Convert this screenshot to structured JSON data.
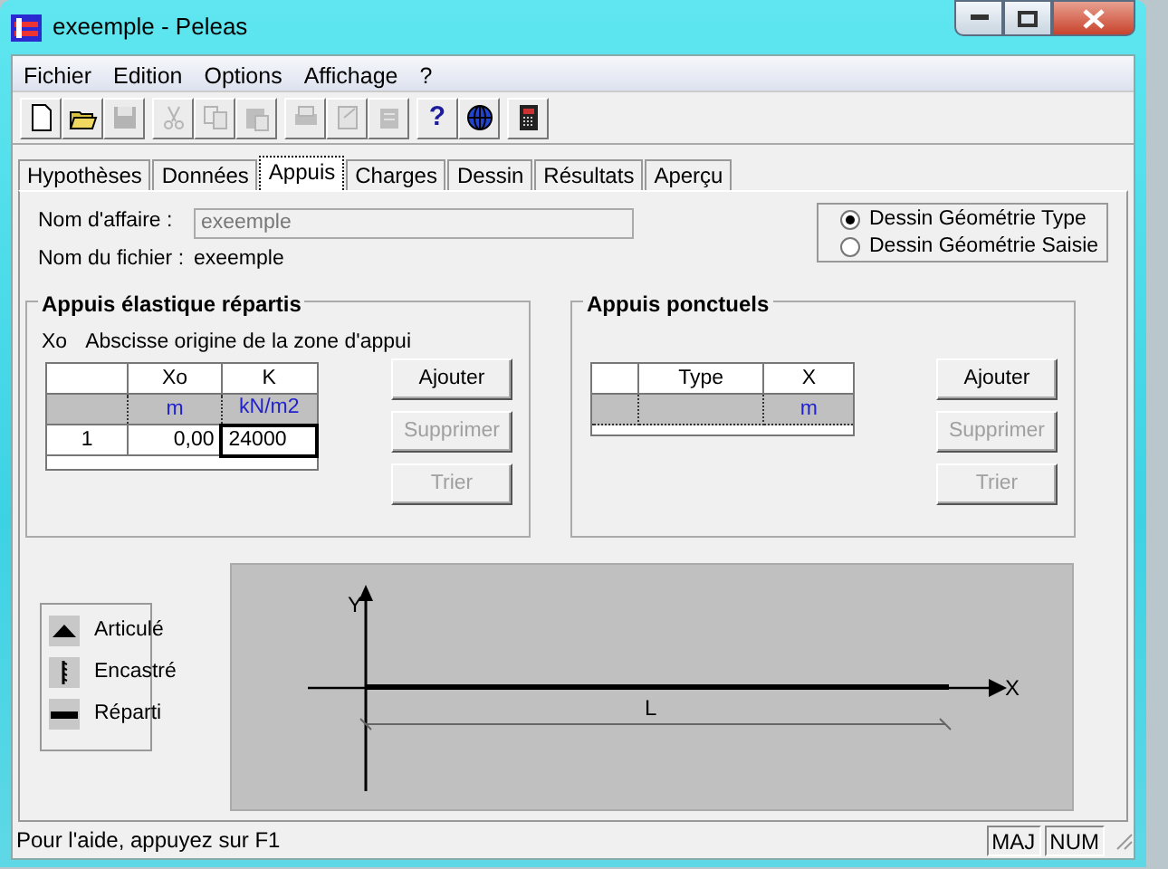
{
  "window": {
    "title": "exeemple - Peleas"
  },
  "menu": [
    "Fichier",
    "Edition",
    "Options",
    "Affichage",
    "?"
  ],
  "toolbar": [
    {
      "kind": "new",
      "disabled": false
    },
    {
      "kind": "open",
      "disabled": false
    },
    {
      "kind": "save",
      "disabled": true
    },
    {
      "kind": "cut",
      "disabled": true
    },
    {
      "kind": "copy",
      "disabled": true
    },
    {
      "kind": "paste",
      "disabled": true
    },
    {
      "kind": "print",
      "disabled": true
    },
    {
      "kind": "setup",
      "disabled": true
    },
    {
      "kind": "preview",
      "disabled": true
    },
    {
      "kind": "help",
      "glyph": "?",
      "disabled": false
    },
    {
      "kind": "globe",
      "disabled": false
    },
    {
      "kind": "calculator",
      "disabled": false
    }
  ],
  "tabs": [
    {
      "label": "Hypothèses",
      "selected": false
    },
    {
      "label": "Données",
      "selected": false
    },
    {
      "label": "Appuis",
      "selected": true
    },
    {
      "label": "Charges",
      "selected": false
    },
    {
      "label": "Dessin",
      "selected": false
    },
    {
      "label": "Résultats",
      "selected": false
    },
    {
      "label": "Aperçu",
      "selected": false
    }
  ],
  "fields": [
    {
      "kind": "input",
      "label": "Nom d'affaire :",
      "value": "exeemple"
    },
    {
      "kind": "text",
      "label": "Nom du fichier :",
      "value": "exeemple"
    }
  ],
  "view_options": [
    {
      "label": "Dessin Géométrie Type",
      "selected": true
    },
    {
      "label": "Dessin Géométrie Saisie",
      "selected": false
    }
  ],
  "groups": [
    {
      "title": "Appuis élastique répartis",
      "note_key": "Xo",
      "note": "Abscisse origine de la zone d'appui",
      "columns": [
        {
          "label": "Xo",
          "unit": "m"
        },
        {
          "label": "K",
          "unit": "kN/m2"
        }
      ],
      "rows": [
        {
          "header": "1",
          "cells": [
            {
              "text": "0,00",
              "selected": false
            },
            {
              "text": "24000",
              "selected": true
            }
          ]
        }
      ],
      "buttons": [
        {
          "label": "Ajouter",
          "disabled": false
        },
        {
          "label": "Supprimer",
          "disabled": true
        },
        {
          "label": "Trier",
          "disabled": true
        }
      ]
    },
    {
      "title": "Appuis ponctuels",
      "columns": [
        {
          "label": "Type"
        },
        {
          "label": "X",
          "unit": "m"
        }
      ],
      "buttons": [
        {
          "label": "Ajouter",
          "disabled": false
        },
        {
          "label": "Supprimer",
          "disabled": true
        },
        {
          "label": "Trier",
          "disabled": true
        }
      ]
    }
  ],
  "legend": [
    {
      "kind": "hinged",
      "label": "Articulé"
    },
    {
      "kind": "fixed",
      "label": "Encastré"
    },
    {
      "kind": "distributed",
      "label": "Réparti"
    }
  ],
  "drawing": {
    "y_label": "Y",
    "x_label": "X",
    "span_label": "L"
  },
  "status_bar": {
    "text": "Pour l'aide, appuyez sur F1",
    "indicators": [
      "MAJ",
      "NUM"
    ]
  }
}
